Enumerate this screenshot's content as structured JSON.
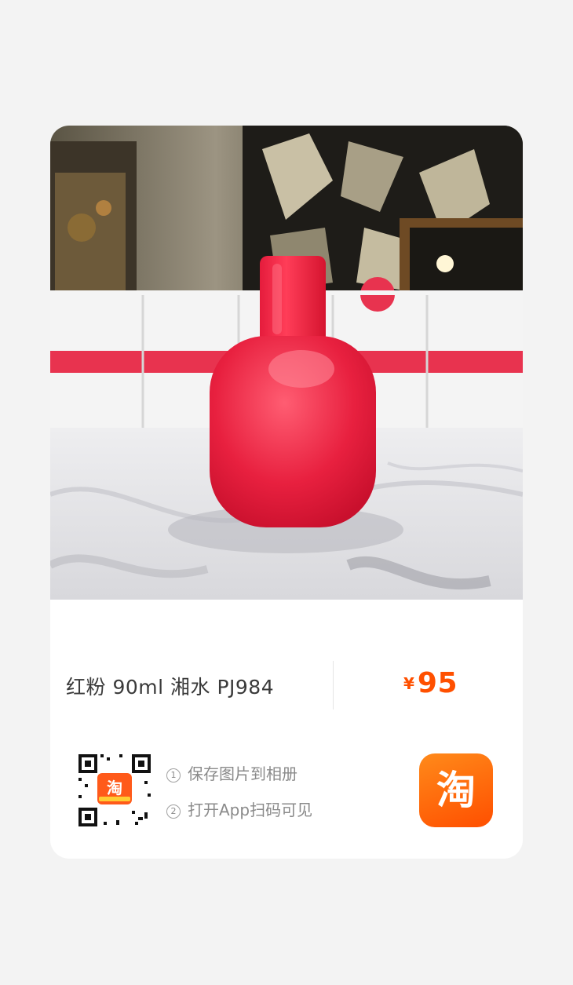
{
  "product": {
    "title": "红粉 90ml 湘水 PJ984",
    "price_currency": "¥",
    "price_value": "95"
  },
  "qr": {
    "badge_glyph": "淘"
  },
  "instructions": {
    "step1_num": "1",
    "step1_text": "保存图片到相册",
    "step2_num": "2",
    "step2_text": "打开App扫码可见"
  },
  "app": {
    "icon_glyph": "淘",
    "accent_color": "#ff5000"
  }
}
